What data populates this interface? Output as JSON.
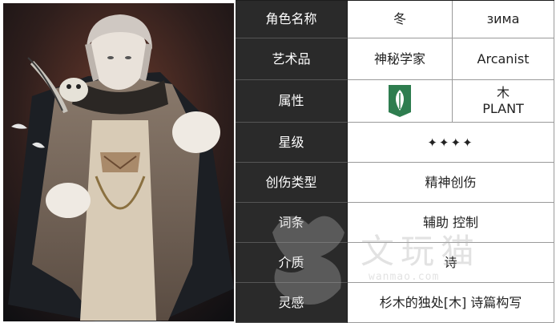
{
  "rows": [
    {
      "label": "角色名称",
      "value1": "冬",
      "value2": "зима"
    },
    {
      "label": "艺术品",
      "value1": "神秘学家",
      "value2": "Arcanist"
    },
    {
      "label": "属性",
      "value2_line1": "木",
      "value2_line2": "PLANT",
      "icon": "plant-leaf-icon"
    },
    {
      "label": "星级",
      "value": "✦✦✦✦"
    },
    {
      "label": "创伤类型",
      "value": "精神创伤"
    },
    {
      "label": "词条",
      "value": "辅助 控制"
    },
    {
      "label": "介质",
      "value": "诗"
    },
    {
      "label": "灵感",
      "value": "杉木的独处[木] 诗篇构写"
    }
  ],
  "watermark": {
    "text": "文玩猫",
    "sub": "wanmao.com"
  },
  "colors": {
    "label_bg": "#2a2a2a",
    "plant_green": "#2e7d4f"
  }
}
